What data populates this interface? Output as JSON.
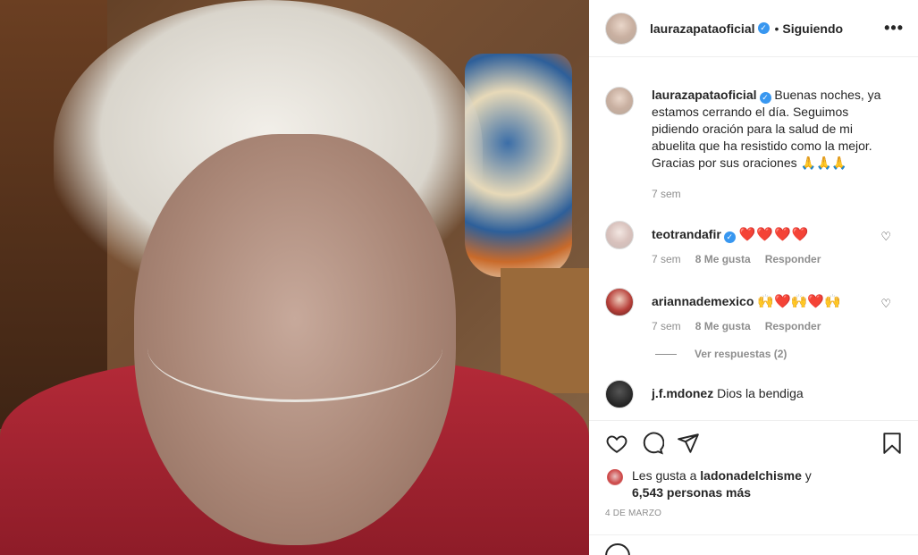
{
  "post": {
    "author": "laurazapataoficial",
    "follow_separator": "•",
    "follow_status": "Siguiendo",
    "more_icon": "more-horizontal-icon",
    "caption": "Buenas noches, ya estamos cerrando el día. Seguimos pidiendo oración para la salud de mi abuelita que ha resistido como la mejor. Gracias por sus oraciones 🙏🙏🙏",
    "caption_time": "7 sem"
  },
  "comments": [
    {
      "user": "teotrandafir",
      "verified": true,
      "text": "❤️❤️❤️❤️",
      "time": "7 sem",
      "likes": "8 Me gusta",
      "reply": "Responder"
    },
    {
      "user": "ariannademexico",
      "verified": false,
      "text": "🙌❤️🙌❤️🙌",
      "time": "7 sem",
      "likes": "8 Me gusta",
      "reply": "Responder",
      "view_replies": "Ver respuestas (2)"
    },
    {
      "user": "j.f.mdonez",
      "text": "Dios la bendiga"
    }
  ],
  "actions": {
    "like_icon": "heart-icon",
    "comment_icon": "comment-icon",
    "share_icon": "share-icon",
    "save_icon": "bookmark-icon"
  },
  "likes": {
    "prefix": "Les gusta a",
    "user": "ladonadelchisme",
    "connector": "y",
    "others": "6,543 personas más"
  },
  "date": "4 DE MARZO",
  "colors": {
    "verified": "#3897f0",
    "text": "#262626",
    "muted": "#8e8e8e",
    "heart": "#ed4956"
  }
}
